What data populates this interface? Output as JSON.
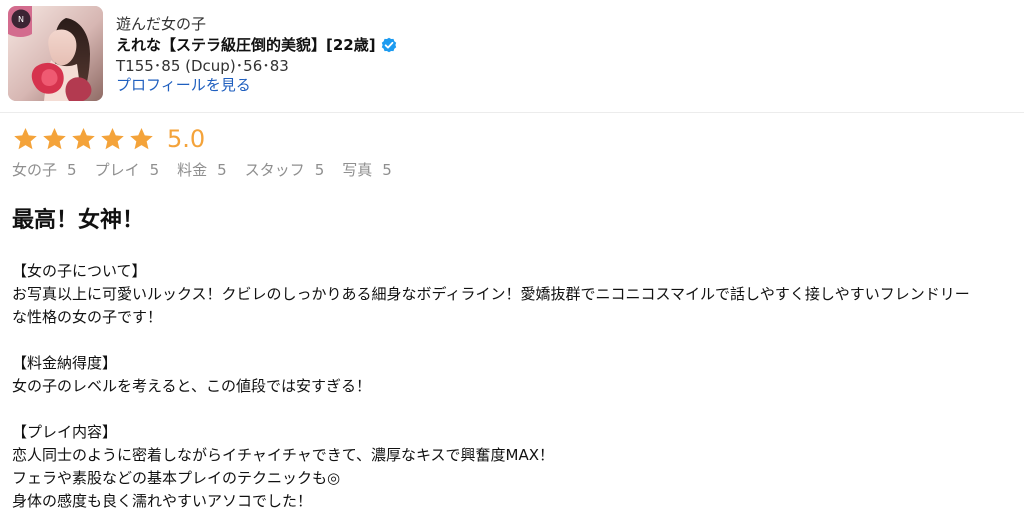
{
  "profile": {
    "section_label": "遊んだ女の子",
    "name": "えれな【ステラ級圧倒的美貌】[22歳]",
    "stats": "T155･85 (Dcup)･56･83",
    "link_label": "プロフィールを見る",
    "verified_icon": "verified-badge-icon",
    "accent_color": "#1f5fbf"
  },
  "rating": {
    "value": "5.0",
    "stars": 5,
    "star_color": "#f4a33a"
  },
  "subscores": [
    {
      "label": "女の子",
      "value": "5"
    },
    {
      "label": "プレイ",
      "value": "5"
    },
    {
      "label": "料金",
      "value": "5"
    },
    {
      "label": "スタッフ",
      "value": "5"
    },
    {
      "label": "写真",
      "value": "5"
    }
  ],
  "review": {
    "title": "最高！女神！",
    "body": [
      "【女の子について】",
      "お写真以上に可愛いルックス！クビレのしっかりある細身なボディライン！愛嬌抜群でニコニコスマイルで話しやすく接しやすいフレンドリー",
      "な性格の女の子です！",
      "",
      "【料金納得度】",
      "女の子のレベルを考えると、この値段では安すぎる！",
      "",
      "【プレイ内容】",
      "恋人同士のように密着しながらイチャイチャできて、濃厚なキスで興奮度MAX！",
      "フェラや素股などの基本プレイのテクニックも◎",
      "身体の感度も良く濡れやすいアソコでした！"
    ]
  }
}
